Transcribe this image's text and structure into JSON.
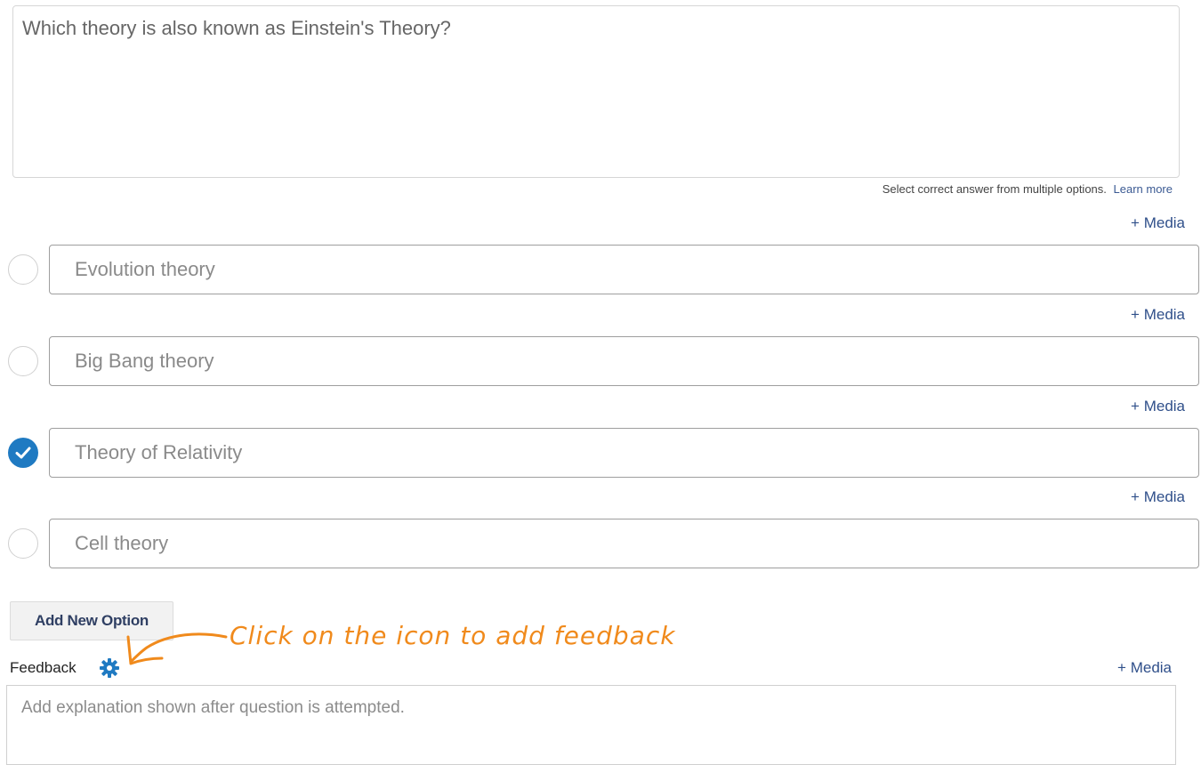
{
  "question": {
    "text": "Which theory is also known as Einstein's Theory?"
  },
  "hint": {
    "text": "Select correct answer from multiple options.",
    "learn_more": "Learn more"
  },
  "media_label": "+ Media",
  "options": [
    {
      "label": "Evolution theory",
      "correct": false
    },
    {
      "label": "Big Bang theory",
      "correct": false
    },
    {
      "label": "Theory of Relativity",
      "correct": true
    },
    {
      "label": "Cell theory",
      "correct": false
    }
  ],
  "add_option_label": "Add New Option",
  "feedback": {
    "label": "Feedback",
    "placeholder": "Add explanation shown after question is attempted."
  },
  "annotation": {
    "text": "Click on the icon to add feedback"
  },
  "icons": {
    "check": "check-icon",
    "settings": "gear-icon"
  },
  "colors": {
    "accent": "#1f7ac2",
    "link": "#2f4f8a",
    "annotation": "#f08a1c"
  }
}
